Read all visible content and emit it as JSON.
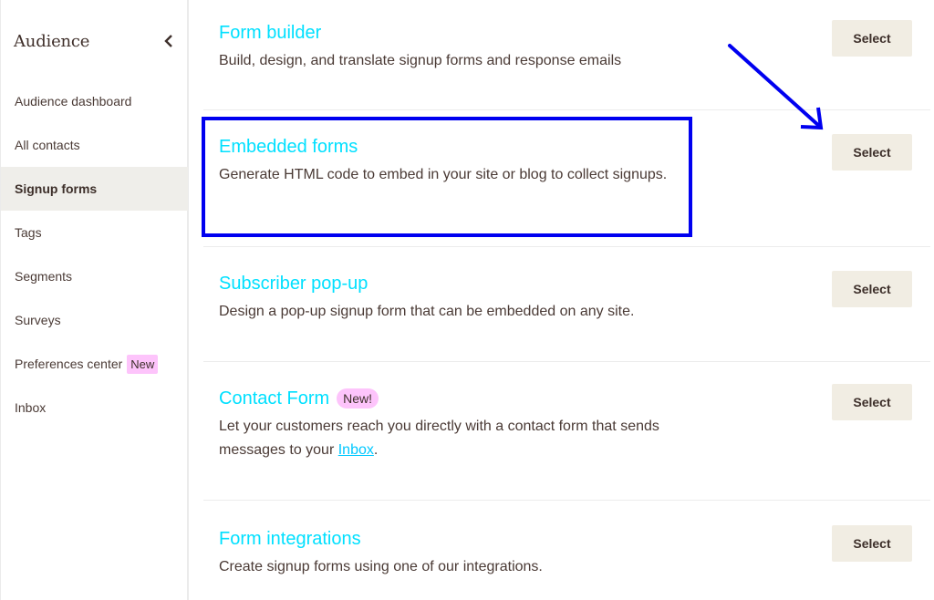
{
  "sidebar": {
    "title": "Audience",
    "collapse_icon": "chevron-left-icon",
    "items": [
      {
        "label": "Audience dashboard",
        "active": false
      },
      {
        "label": "All contacts",
        "active": false
      },
      {
        "label": "Signup forms",
        "active": true
      },
      {
        "label": "Tags",
        "active": false
      },
      {
        "label": "Segments",
        "active": false
      },
      {
        "label": "Surveys",
        "active": false
      },
      {
        "label": "Preferences center",
        "active": false,
        "badge": "New"
      },
      {
        "label": "Inbox",
        "active": false
      }
    ]
  },
  "forms": [
    {
      "title": "Form builder",
      "description": "Build, design, and translate signup forms and response emails",
      "button": "Select"
    },
    {
      "title": "Embedded forms",
      "description": "Generate HTML code to embed in your site or blog to collect signups.",
      "button": "Select",
      "highlighted": true
    },
    {
      "title": "Subscriber pop-up",
      "description": "Design a pop-up signup form that can be embedded on any site.",
      "button": "Select"
    },
    {
      "title": "Contact Form",
      "badge": "New!",
      "description_prefix": "Let your customers reach you directly with a contact form that sends messages to your ",
      "description_link": "Inbox",
      "description_suffix": ".",
      "button": "Select"
    },
    {
      "title": "Form integrations",
      "description": "Create signup forms using one of our integrations.",
      "button": "Select"
    }
  ],
  "colors": {
    "title_link": "#00e0ff",
    "badge_bg": "#fdc4fb",
    "button_bg": "#f1ede3",
    "active_nav_bg": "#efeeea",
    "annotation": "#0000f0"
  },
  "annotations": {
    "highlight_target": "Embedded forms",
    "arrow_target": "Embedded forms Select button"
  }
}
